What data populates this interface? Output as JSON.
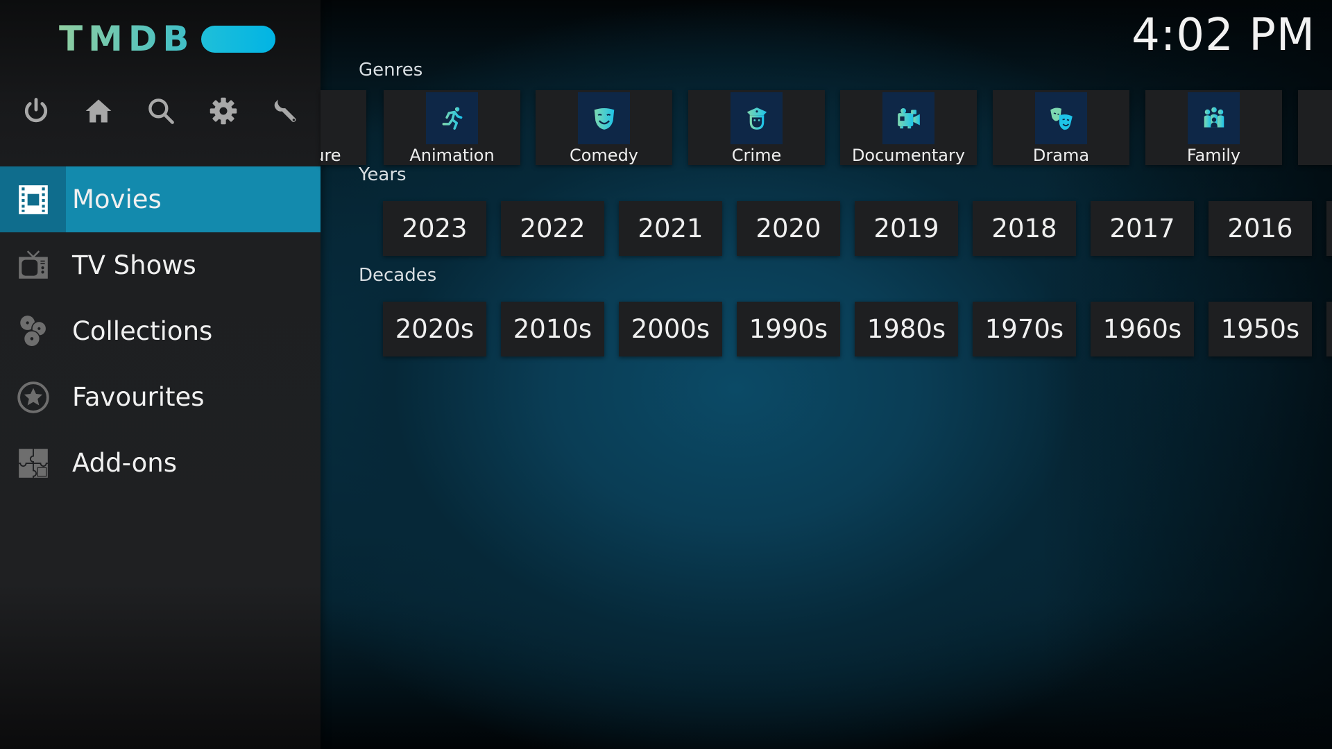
{
  "app": {
    "logo_text": "TMDB",
    "clock": "4:02 PM"
  },
  "colors": {
    "accent": "#138aad",
    "accent_dark": "#0f6d8d",
    "logo_gradient_start": "#90cea1",
    "logo_gradient_end": "#01b4e4",
    "icon_gradient_start": "#7dd8b0",
    "icon_gradient_end": "#1ec3e8",
    "sidebar_icon": "#6e6e6e",
    "top_icon": "#a8a8a8"
  },
  "top_icons": [
    {
      "name": "power-icon",
      "label": "Power"
    },
    {
      "name": "home-icon",
      "label": "Home"
    },
    {
      "name": "search-icon",
      "label": "Search"
    },
    {
      "name": "gear-icon",
      "label": "Settings"
    },
    {
      "name": "wrench-icon",
      "label": "Tools"
    }
  ],
  "sidebar": {
    "items": [
      {
        "label": "Movies",
        "icon": "film-icon",
        "active": true
      },
      {
        "label": "TV Shows",
        "icon": "tv-icon",
        "active": false
      },
      {
        "label": "Collections",
        "icon": "collections-icon",
        "active": false
      },
      {
        "label": "Favourites",
        "icon": "star-icon",
        "active": false
      },
      {
        "label": "Add-ons",
        "icon": "puzzle-icon",
        "active": false
      }
    ]
  },
  "main": {
    "genres": {
      "label": "Genres",
      "items": [
        {
          "label": "Adventure",
          "icon": "adventure-icon",
          "partial": true
        },
        {
          "label": "Animation",
          "icon": "running-figure-icon"
        },
        {
          "label": "Comedy",
          "icon": "comedy-mask-icon"
        },
        {
          "label": "Crime",
          "icon": "police-officer-icon"
        },
        {
          "label": "Documentary",
          "icon": "video-camera-icon"
        },
        {
          "label": "Drama",
          "icon": "drama-masks-icon"
        },
        {
          "label": "Family",
          "icon": "family-icon"
        }
      ]
    },
    "years": {
      "label": "Years",
      "items": [
        "2023",
        "2022",
        "2021",
        "2020",
        "2019",
        "2018",
        "2017",
        "2016"
      ]
    },
    "decades": {
      "label": "Decades",
      "items": [
        "2020s",
        "2010s",
        "2000s",
        "1990s",
        "1980s",
        "1970s",
        "1960s",
        "1950s"
      ]
    }
  }
}
